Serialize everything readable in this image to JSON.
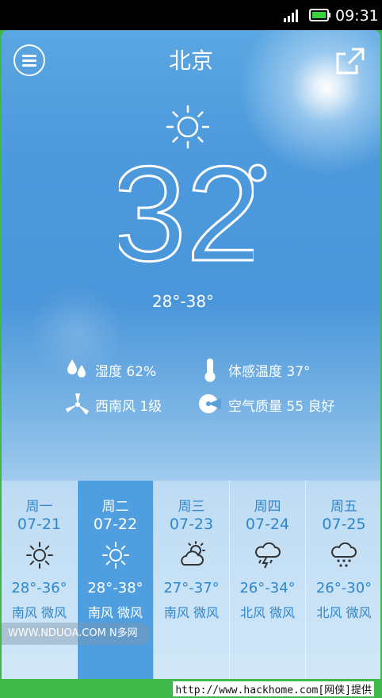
{
  "status_bar": {
    "time": "09:31",
    "icons": [
      "signal-icon",
      "battery-icon"
    ]
  },
  "header": {
    "city": "北京",
    "menu_icon": "menu-icon",
    "share_icon": "share-icon"
  },
  "current": {
    "condition_icon": "sun-icon",
    "temperature": "32",
    "degree_symbol": "°",
    "range": "28°-38°"
  },
  "details": {
    "humidity": "湿度 62%",
    "feels_like": "体感温度 37°",
    "wind": "西南风 1级",
    "air_quality": "空气质量 55 良好"
  },
  "forecast": [
    {
      "weekday": "周一",
      "date": "07-21",
      "icon": "sun-icon",
      "temp_range": "28°-36°",
      "wind": "南风 微风",
      "selected": false
    },
    {
      "weekday": "周二",
      "date": "07-22",
      "icon": "sun-icon",
      "temp_range": "28°-38°",
      "wind": "南风 微风",
      "selected": true
    },
    {
      "weekday": "周三",
      "date": "07-23",
      "icon": "partly-cloudy-icon",
      "temp_range": "27°-37°",
      "wind": "南风 微风",
      "selected": false
    },
    {
      "weekday": "周四",
      "date": "07-24",
      "icon": "thunderstorm-icon",
      "temp_range": "26°-34°",
      "wind": "北风 微风",
      "selected": false
    },
    {
      "weekday": "周五",
      "date": "07-25",
      "icon": "rain-icon",
      "temp_range": "26°-30°",
      "wind": "北风 微风",
      "selected": false
    }
  ],
  "watermark": "WWW.NDUOA.COM N多网",
  "footer": "http://www.hackhome.com[网侠]提供",
  "colors": {
    "accent": "#2f86cf",
    "selected_day": "#4e9ee0",
    "status_bar": "#000000",
    "footer": "#3fb84a"
  }
}
